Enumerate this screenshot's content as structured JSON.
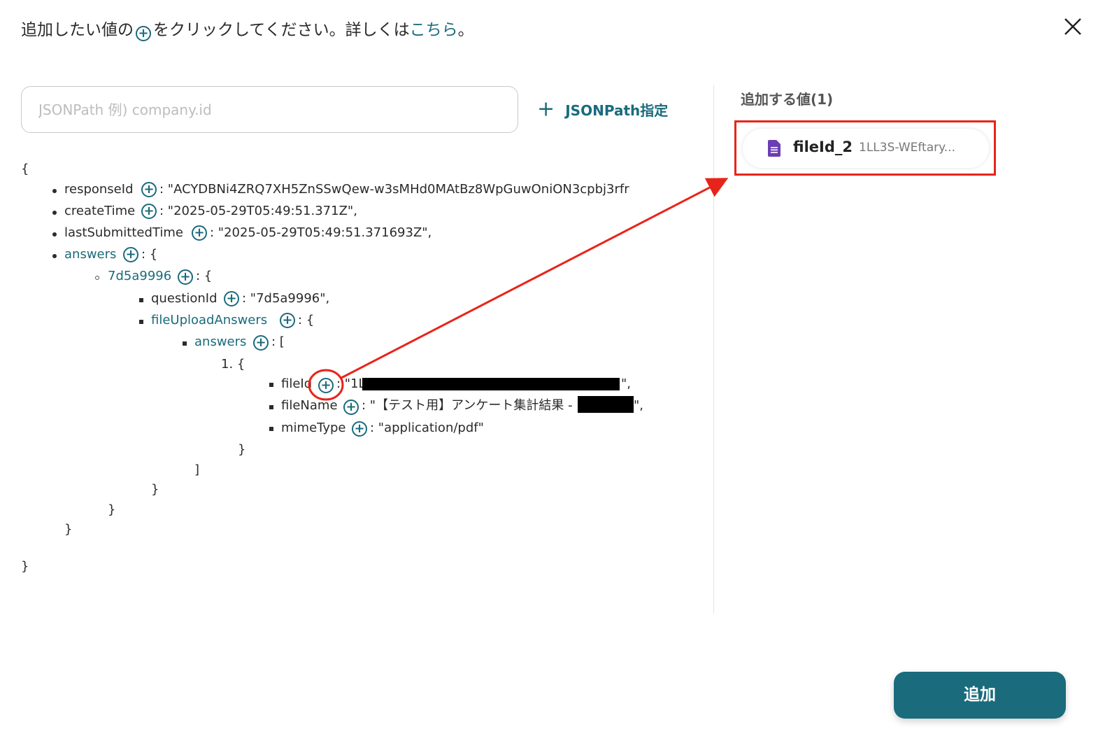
{
  "header": {
    "instruction_pre": "追加したい値の",
    "instruction_post": "をクリックしてください。詳しくは",
    "link": "こちら",
    "instruction_end": "。"
  },
  "search": {
    "placeholder": "JSONPath 例) company.id"
  },
  "jsonpath_button": "JSONPath指定",
  "right": {
    "title": "追加する値(1)",
    "chip_name": "fileId_2",
    "chip_value": "1LL3S-WEftary..."
  },
  "tree": {
    "open_brace": "{",
    "l1_key": "responseId",
    "l1_val": ": \"ACYDBNi4ZRQ7XH5ZnSSwQew-w3sMHd0MAtBz8WpGuwOniON3cpbj3rfr",
    "l2_key": "createTime",
    "l2_val": ": \"2025-05-29T05:49:51.371Z\",",
    "l3_key": "lastSubmittedTime",
    "l3_val": ": \"2025-05-29T05:49:51.371693Z\",",
    "l4_key": "answers",
    "l4_val": ": {",
    "l5_key": "7d5a9996",
    "l5_val": ": {",
    "l6_key": "questionId",
    "l6_val": ": \"7d5a9996\",",
    "l7_key": "fileUploadAnswers",
    "l7_val": ": {",
    "l8_key": "answers",
    "l8_val": ": [",
    "l9": "1. {",
    "l10_key": "fileId",
    "l10_val": ": \"1L",
    "l10_end": "\",",
    "l11_key": "fileName",
    "l11_val": ": \"【テスト用】アンケート集計結果  - ",
    "l11_end": "\",",
    "l12_key": "mimeType",
    "l12_val": ": \"application/pdf\"",
    "close1": "}",
    "close2": "]",
    "close3": "}",
    "close4": "}",
    "close5": "}",
    "close6": "}"
  },
  "add_button": "追加",
  "colors": {
    "accent": "#1a6b7c",
    "highlight": "#e8241a",
    "doc_icon": "#6b3fb4"
  }
}
